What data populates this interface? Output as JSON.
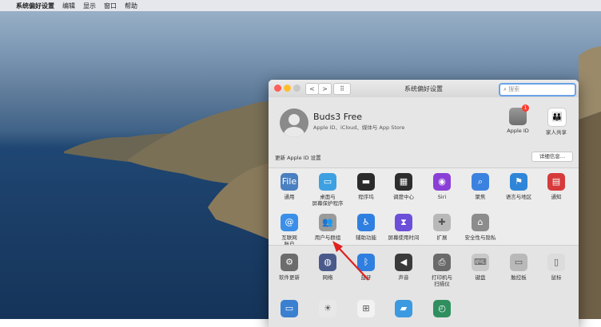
{
  "menubar": {
    "apple": "",
    "app_name": "系统偏好设置",
    "menus": [
      "编辑",
      "显示",
      "窗口",
      "帮助"
    ]
  },
  "window": {
    "title": "系统偏好设置",
    "back": "<",
    "forward": ">",
    "grid": "⠿",
    "search_placeholder": "搜索"
  },
  "account": {
    "name": "Buds3 Free",
    "subtitle": "Apple ID、iCloud、媒体与 App Store",
    "update_text": "更新 Apple ID 设置",
    "details_button": "详细信息…",
    "apple_id_label": "Apple ID",
    "apple_id_badge": "1",
    "family_label": "家人共享"
  },
  "row1": [
    {
      "label": "通用",
      "icon": "general-icon",
      "color": "#4a7fc1",
      "glyph": "File"
    },
    {
      "label": "桌面与\n屏幕保护程序",
      "icon": "desktop-icon",
      "color": "#3da0e0",
      "glyph": "▭"
    },
    {
      "label": "程序坞",
      "icon": "dock-icon",
      "color": "#2b2b2b",
      "glyph": "▬"
    },
    {
      "label": "调度中心",
      "icon": "mission-control-icon",
      "color": "#2d2d2d",
      "glyph": "▦"
    },
    {
      "label": "Siri",
      "icon": "siri-icon",
      "color": "#8a3fd6",
      "glyph": "◉"
    },
    {
      "label": "聚焦",
      "icon": "spotlight-icon",
      "color": "#3b82e0",
      "glyph": "⌕"
    },
    {
      "label": "语言与地区",
      "icon": "language-icon",
      "color": "#2f86d8",
      "glyph": "⚑"
    },
    {
      "label": "通知",
      "icon": "notifications-icon",
      "color": "#d63a3a",
      "glyph": "▤"
    }
  ],
  "row2": [
    {
      "label": "互联网\n账户",
      "icon": "internet-accounts-icon",
      "color": "#3b8fe8",
      "glyph": "@"
    },
    {
      "label": "用户与群组",
      "icon": "users-groups-icon",
      "color": "#9a9a9a",
      "glyph": "👥"
    },
    {
      "label": "辅助功能",
      "icon": "accessibility-icon",
      "color": "#2f7fe0",
      "glyph": "♿"
    },
    {
      "label": "屏幕使用时间",
      "icon": "screen-time-icon",
      "color": "#6b4fd8",
      "glyph": "⧗"
    },
    {
      "label": "扩展",
      "icon": "extensions-icon",
      "color": "#b8b8b8",
      "glyph": "✚"
    },
    {
      "label": "安全性与隐私",
      "icon": "security-icon",
      "color": "#8c8c8c",
      "glyph": "⌂"
    }
  ],
  "row3": [
    {
      "label": "软件更新",
      "icon": "software-update-icon",
      "color": "#6c6c6c",
      "glyph": "⚙"
    },
    {
      "label": "网络",
      "icon": "network-icon",
      "color": "#4a5a8a",
      "glyph": "◍"
    },
    {
      "label": "蓝牙",
      "icon": "bluetooth-icon",
      "color": "#2f7fe0",
      "glyph": "ᛒ"
    },
    {
      "label": "声音",
      "icon": "sound-icon",
      "color": "#3a3a3a",
      "glyph": "◀"
    },
    {
      "label": "打印机与\n扫描仪",
      "icon": "printer-icon",
      "color": "#6a6a6a",
      "glyph": "⎙"
    },
    {
      "label": "键盘",
      "icon": "keyboard-icon",
      "color": "#c8c8c8",
      "glyph": "⌨"
    },
    {
      "label": "触控板",
      "icon": "trackpad-icon",
      "color": "#b9b9b9",
      "glyph": "▭"
    },
    {
      "label": "鼠标",
      "icon": "mouse-icon",
      "color": "#dcdcdc",
      "glyph": "▯"
    }
  ],
  "row4": [
    {
      "icon": "displays-icon",
      "color": "#3b7fd0",
      "glyph": "▭"
    },
    {
      "icon": "energy-saver-icon",
      "color": "#e8e8e8",
      "glyph": "☀"
    },
    {
      "icon": "date-time-icon",
      "color": "#f2f2f2",
      "glyph": "⊞"
    },
    {
      "icon": "sharing-icon",
      "color": "#3c9ae0",
      "glyph": "▰"
    },
    {
      "icon": "time-machine-icon",
      "color": "#2f8f5f",
      "glyph": "◴"
    }
  ]
}
